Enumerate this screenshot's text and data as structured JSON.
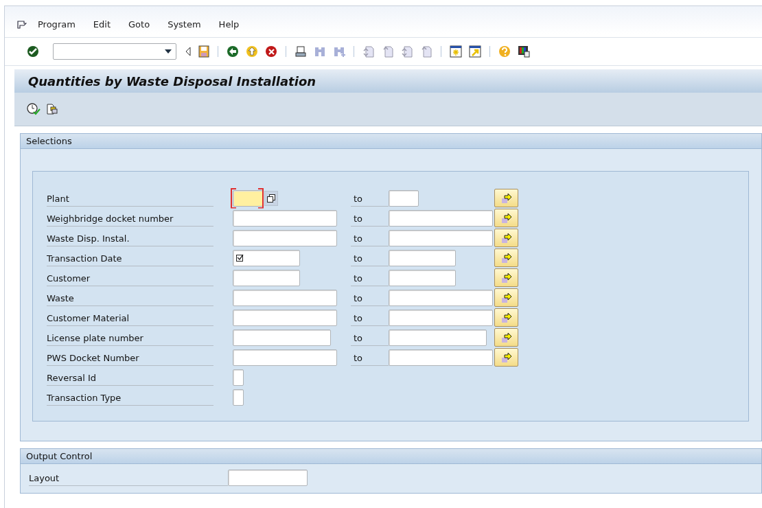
{
  "menu": [
    {
      "label": "Program"
    },
    {
      "label": "Edit"
    },
    {
      "label": "Goto"
    },
    {
      "label": "System"
    },
    {
      "label": "Help"
    }
  ],
  "title": "Quantities by Waste Disposal Installation",
  "selections": {
    "title": "Selections",
    "rows": [
      {
        "kind": "range",
        "label": "Plant",
        "focused": true,
        "required": false,
        "value_help": true,
        "to_label": "to"
      },
      {
        "kind": "range",
        "label": "Weighbridge docket number",
        "focused": false,
        "required": false,
        "value_help": false,
        "to_label": "to"
      },
      {
        "kind": "range",
        "label": "Waste Disp. Instal.",
        "focused": false,
        "required": false,
        "value_help": false,
        "to_label": "to"
      },
      {
        "kind": "range",
        "label": "Transaction Date",
        "focused": false,
        "required": true,
        "value_help": false,
        "to_label": "to"
      },
      {
        "kind": "range",
        "label": "Customer",
        "focused": false,
        "required": false,
        "value_help": false,
        "to_label": "to"
      },
      {
        "kind": "range",
        "label": "Waste",
        "focused": false,
        "required": false,
        "value_help": false,
        "to_label": "to"
      },
      {
        "kind": "range",
        "label": "Customer Material",
        "focused": false,
        "required": false,
        "value_help": false,
        "to_label": "to"
      },
      {
        "kind": "range",
        "label": "License plate number",
        "focused": false,
        "required": false,
        "value_help": false,
        "to_label": "to"
      },
      {
        "kind": "range",
        "label": "PWS Docket Number",
        "focused": false,
        "required": false,
        "value_help": false,
        "to_label": "to"
      },
      {
        "kind": "single",
        "label": "Reversal Id",
        "focused": false,
        "required": false,
        "value_help": false
      },
      {
        "kind": "single",
        "label": "Transaction Type",
        "focused": false,
        "required": false,
        "value_help": false
      }
    ]
  },
  "output_control": {
    "title": "Output Control",
    "rows": [
      {
        "label": "Layout"
      }
    ]
  }
}
